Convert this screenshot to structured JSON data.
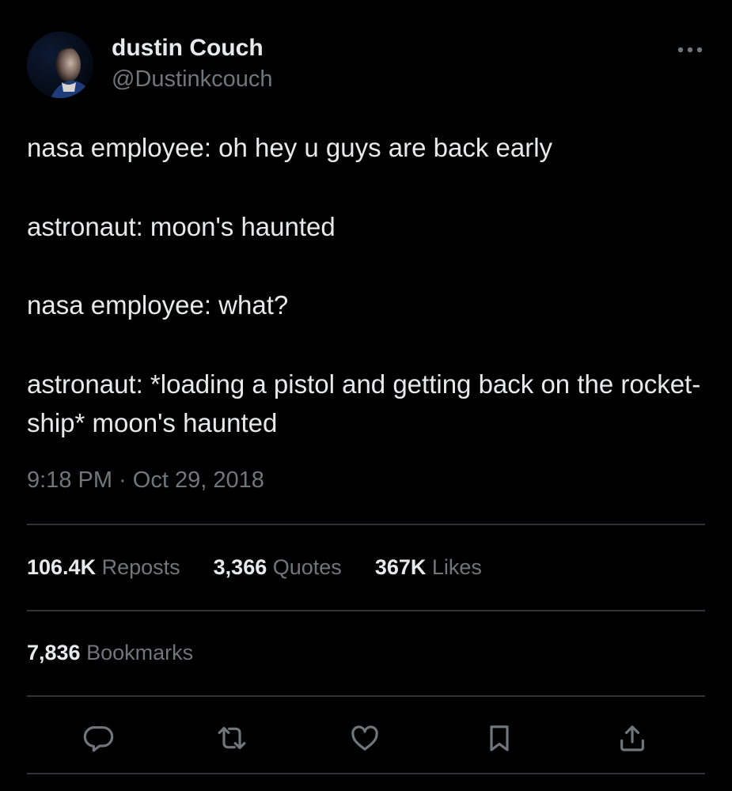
{
  "tweet": {
    "display_name": "dustin Couch",
    "handle": "@Dustinkcouch",
    "paragraphs": [
      "nasa employee: oh hey u guys are back early",
      "astronaut: moon's haunted",
      "nasa employee: what?",
      "astronaut: *loading a pistol and getting back on the rocket-ship* moon's haunted"
    ],
    "timestamp": "9:18 PM · Oct 29, 2018",
    "stats": {
      "reposts_count": "106.4K",
      "reposts_label": "Reposts",
      "quotes_count": "3,366",
      "quotes_label": "Quotes",
      "likes_count": "367K",
      "likes_label": "Likes",
      "bookmarks_count": "7,836",
      "bookmarks_label": "Bookmarks"
    }
  },
  "icons": {
    "more": "more-horizontal-icon",
    "reply": "reply-icon",
    "repost": "repost-icon",
    "like": "heart-icon",
    "bookmark": "bookmark-icon",
    "share": "share-icon"
  },
  "colors": {
    "background": "#000000",
    "text_primary": "#e7e9ea",
    "text_secondary": "#71767b",
    "divider": "#2f3336"
  }
}
